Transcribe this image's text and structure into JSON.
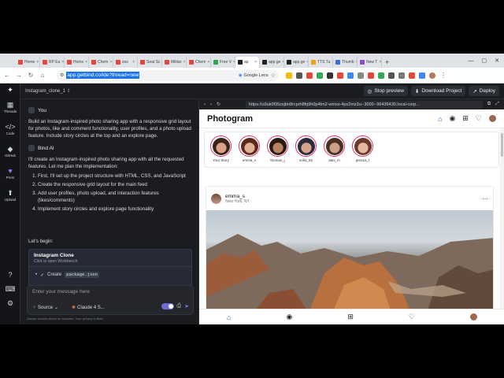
{
  "browser": {
    "tabs": [
      {
        "label": "Home",
        "color": "#e8453c",
        "active": false
      },
      {
        "label": "RP Eu",
        "color": "#e8453c",
        "active": false
      },
      {
        "label": "Homs",
        "color": "#e8453c",
        "active": false
      },
      {
        "label": "Chem",
        "color": "#e8453c",
        "active": false
      },
      {
        "label": "sos",
        "color": "#e8453c",
        "active": false
      },
      {
        "label": "Seat Sc",
        "color": "#e8453c",
        "active": false
      },
      {
        "label": "Militar",
        "color": "#e8453c",
        "active": false
      },
      {
        "label": "Chem",
        "color": "#e8453c",
        "active": false
      },
      {
        "label": "Free V",
        "color": "#2da44e",
        "active": false
      },
      {
        "label": "ap",
        "color": "#222222",
        "active": true
      },
      {
        "label": "app.ge",
        "color": "#222222",
        "active": false
      },
      {
        "label": "app.ge",
        "color": "#222222",
        "active": false
      },
      {
        "label": "TTS Tu",
        "color": "#f2a20a",
        "active": false
      },
      {
        "label": "Thumb",
        "color": "#3b6fd8",
        "active": false
      },
      {
        "label": "New T",
        "color": "#8a4ad8",
        "active": false
      }
    ],
    "url": "app.getbind.co/ide?thread=new",
    "lens_label": "Google Lens"
  },
  "sidebar": [
    {
      "label": "Threads",
      "icon": "grid-icon",
      "glyph": "▦"
    },
    {
      "label": "Code",
      "icon": "code-icon",
      "glyph": "</>"
    },
    {
      "label": "GitHub",
      "icon": "github-icon",
      "glyph": "◆"
    },
    {
      "label": "Prem",
      "icon": "heart-icon",
      "glyph": "♥"
    },
    {
      "label": "Upload",
      "icon": "upload-icon",
      "glyph": "⬆"
    }
  ],
  "topbar": {
    "project": "Instagram_clone_1",
    "stop_preview": "Stop preview",
    "download": "Download Project",
    "deploy": "Deploy"
  },
  "chat": {
    "user_name": "You",
    "user_message": "Build an Instagram-inspired photo sharing app with a responsive grid layout for photos, like and comment functionality, user profiles, and a photo upload feature. Include story circles at the top and an explore page.",
    "ai_name": "Bind AI",
    "ai_intro": "I'll create an Instagram-inspired photo sharing app with all the requested features. Let me plan the implementation:",
    "steps": [
      "First, I'll set up the project structure with HTML, CSS, and JavaScript",
      "Create the responsive grid layout for the main feed",
      "Add user profiles, photo upload, and interaction features (likes/comments)",
      "Implement story circles and explore page functionality"
    ],
    "lets_begin": "Let's begin:",
    "artifact_title": "Instagram Clone",
    "artifact_sub": "Click to open Workbench",
    "artifact_step": "Create",
    "artifact_file": "package.json",
    "input_placeholder": "Enter your message here",
    "source_label": "Source",
    "model_label": "Claude 4 S...",
    "footnote": "Always double-check for answers. Your privacy is Bind"
  },
  "preview": {
    "url": "https://u9uk0f35zsjbn8rcprh8fq9h0p4tm2-wmxx-4px2mz3u--3000--96436430.local-corp...",
    "app_name": "Photogram",
    "stories": [
      {
        "name": "Your Story",
        "skin": "#d9a189",
        "hair": "#3a2418"
      },
      {
        "name": "emma_s",
        "skin": "#e0b096",
        "hair": "#5a2a1c"
      },
      {
        "name": "thomas_j",
        "skin": "#b98262",
        "hair": "#2a1a12"
      },
      {
        "name": "sofia_92",
        "skin": "#d7a48a",
        "hair": "#2b2b3a"
      },
      {
        "name": "alex_m",
        "skin": "#caa08a",
        "hair": "#4a3020"
      },
      {
        "name": "jessica_t",
        "skin": "#e3b8a0",
        "hair": "#6a3a2a"
      }
    ],
    "post": {
      "user": "emma_s",
      "location": "New York, NY"
    }
  }
}
